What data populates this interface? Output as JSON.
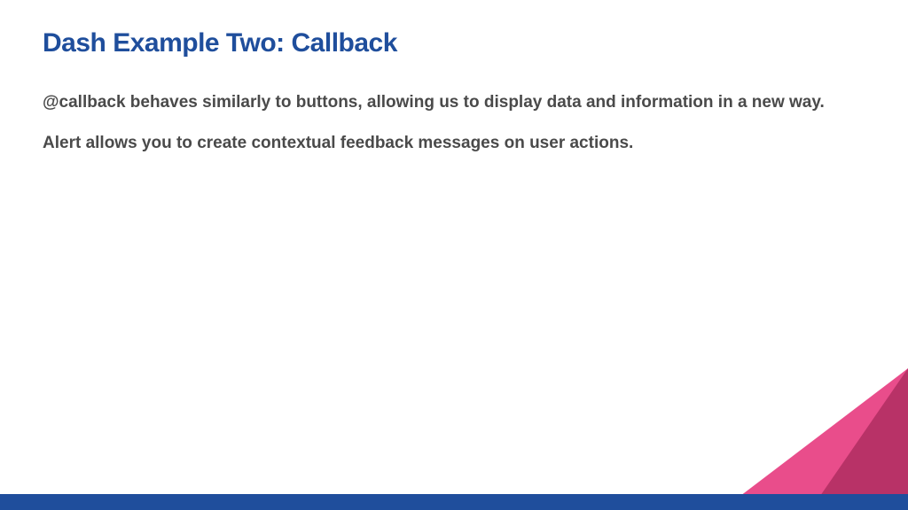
{
  "slide": {
    "title": "Dash Example Two: Callback",
    "paragraph1": "@callback behaves similarly to buttons, allowing us to display data and information in a new way.",
    "paragraph2": "Alert allows you to create contextual feedback messages on user actions."
  },
  "colors": {
    "title": "#1f4e9c",
    "body": "#4a4a4a",
    "footer_bar": "#1f4e9c",
    "triangle_light": "#e94d8b",
    "triangle_dark": "#b83267"
  }
}
